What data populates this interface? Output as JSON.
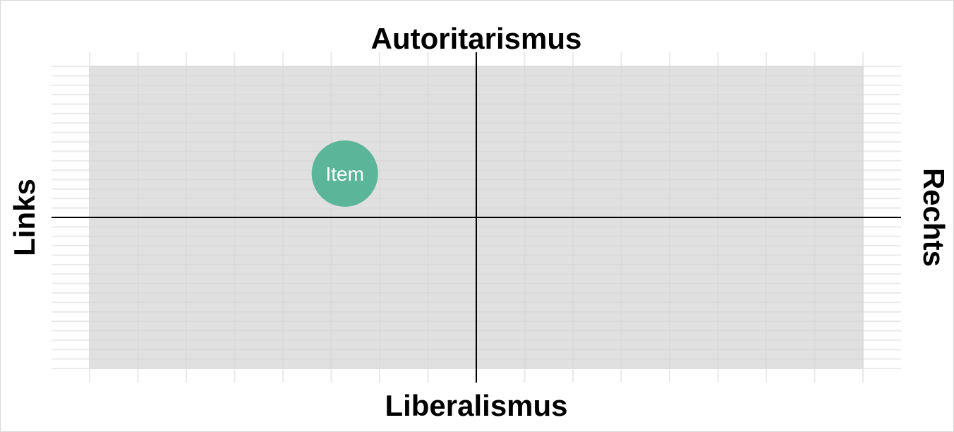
{
  "chart_data": {
    "type": "scatter",
    "title": "",
    "axis_labels": {
      "top": "Autoritarismus",
      "bottom": "Liberalismus",
      "left": "Links",
      "right": "Rechts"
    },
    "xlim": [
      -10,
      10
    ],
    "ylim": [
      -10,
      10
    ],
    "grid": true,
    "points": [
      {
        "x": -3.4,
        "y": 2.9,
        "label": "Item"
      }
    ],
    "colors": {
      "panel": "#e0e0e0",
      "grid": "#eaeaea",
      "axis": "#000000",
      "point": "#5bb598",
      "point_label": "#ffffff"
    }
  }
}
